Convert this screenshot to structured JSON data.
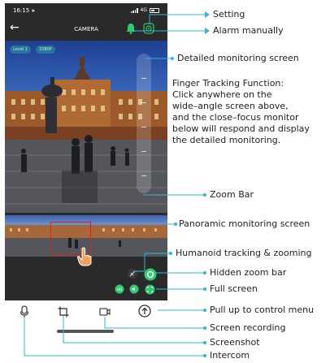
{
  "status": {
    "time": "16:15",
    "network": "4G"
  },
  "nav": {
    "title": "CAMERA",
    "back_icon": "back-arrow-icon"
  },
  "overlay": {
    "chip1": "Level 1",
    "chip2": "1080P"
  },
  "callouts": {
    "setting": "Setting",
    "alarm": "Alarm manually",
    "detailed": "Detailed monitoring screen",
    "finger_title": "Finger Tracking Function:",
    "finger_lines": [
      "Click anywhere on the",
      "wide–angle screen above,",
      "and the close–focus monitor",
      "below will respond and display",
      "the detailed monitoring."
    ],
    "zoom_bar": "Zoom Bar",
    "panoramic": "Panoramic monitoring screen",
    "humanoid": "Humanoid tracking & zooming",
    "hidden_zoom": "Hidden zoom bar",
    "full_screen": "Full screen",
    "pull_up": "Pull up to control menu",
    "screen_recording": "Screen recording",
    "screenshot": "Screenshot",
    "intercom": "Intercom"
  },
  "colors": {
    "accent": "#2fb6d8",
    "green": "#2ecc71",
    "panel": "#2a2a2a"
  }
}
